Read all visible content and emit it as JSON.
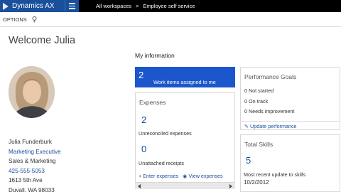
{
  "app": {
    "title": "Dynamics AX"
  },
  "breadcrumb": [
    "All workspaces",
    "Employee self service"
  ],
  "breadcrumb_separator": ">",
  "options_label": "OPTIONS",
  "welcome": "Welcome Julia",
  "person": {
    "name": "Julia Funderburk",
    "title": "Marketing Executive",
    "department": "Sales & Marketing",
    "phone": "425-555-5053",
    "address1": "1613 5th Ave",
    "address2": "Duvall, WA 98033"
  },
  "my_information": "My information",
  "work_items": {
    "count": "2",
    "label": "Work items assigned to me"
  },
  "expenses": {
    "title": "Expenses",
    "unreconciled_count": "2",
    "unreconciled_label": "Unreconciled expenses",
    "unattached_count": "0",
    "unattached_label": "Unattached receipts",
    "enter_link": "Enter expenses",
    "view_link": "View expenses"
  },
  "performance": {
    "title": "Performance Goals",
    "items": [
      "0 Not started",
      "0 On track",
      "0 Needs improvement"
    ],
    "update_link": "Update performance"
  },
  "skills": {
    "title": "Total Skills",
    "count": "5",
    "recent_label": "Most recent update to skills",
    "recent_date": "10/2/2012"
  },
  "colors": {
    "brand": "#1a4f9c",
    "tile_blue": "#1c56cc",
    "topbar": "#000000"
  }
}
